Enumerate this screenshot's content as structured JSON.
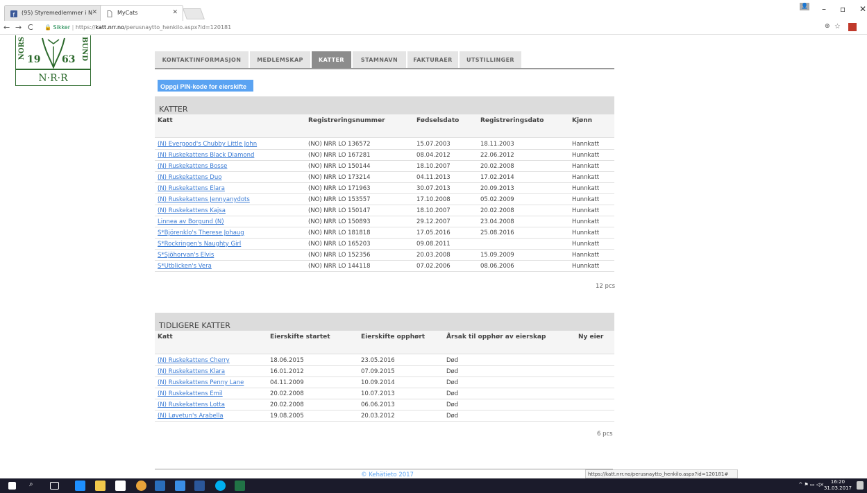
{
  "browser": {
    "tabs": [
      {
        "label": "(95) Styremedlemmer i N"
      },
      {
        "label": "MyCats"
      }
    ],
    "secure_label": "Sikker",
    "url_prefix": "https://",
    "url_host": "katt.nrr.no",
    "url_path": "/perusnaytto_henkilo.aspx?id=120181"
  },
  "logo": {
    "side_left": "NORS",
    "side_right": "BUND",
    "year_left": "19",
    "year_right": "63",
    "subtitle": "N·R·R"
  },
  "nav": {
    "tabs": [
      {
        "label": "KONTAKTINFORMASJON"
      },
      {
        "label": "MEDLEMSKAP"
      },
      {
        "label": "KATTER"
      },
      {
        "label": "STAMNAVN"
      },
      {
        "label": "FAKTURAER"
      },
      {
        "label": "UTSTILLINGER"
      }
    ]
  },
  "pin_button_label": "Oppgi PIN-kode for eierskifte",
  "katter": {
    "title": "KATTER",
    "headers": [
      "Katt",
      "Registreringsnummer",
      "Fødselsdato",
      "Registreringsdato",
      "Kjønn"
    ],
    "rows": [
      [
        "(N) Evergood's Chubby Little John",
        "(NO) NRR LO 136572",
        "15.07.2003",
        "18.11.2003",
        "Hannkatt"
      ],
      [
        "(N) Ruskekattens Black Diamond",
        "(NO) NRR LO 167281",
        "08.04.2012",
        "22.06.2012",
        "Hunnkatt"
      ],
      [
        "(N) Ruskekattens Bosse",
        "(NO) NRR LO 150144",
        "18.10.2007",
        "20.02.2008",
        "Hannkatt"
      ],
      [
        "(N) Ruskekattens Duo",
        "(NO) NRR LO 173214",
        "04.11.2013",
        "17.02.2014",
        "Hannkatt"
      ],
      [
        "(N) Ruskekattens Elara",
        "(NO) NRR LO 171963",
        "30.07.2013",
        "20.09.2013",
        "Hunnkatt"
      ],
      [
        "(N) Ruskekattens Jennyanydots",
        "(NO) NRR LO 153557",
        "17.10.2008",
        "05.02.2009",
        "Hunnkatt"
      ],
      [
        "(N) Ruskekattens Kajsa",
        "(NO) NRR LO 150147",
        "18.10.2007",
        "20.02.2008",
        "Hunnkatt"
      ],
      [
        "Linnea av Borgund (N)",
        "(NO) NRR LO 150893",
        "29.12.2007",
        "23.04.2008",
        "Hunnkatt"
      ],
      [
        "S*Björenklo's Therese Johaug",
        "(NO) NRR LO 181818",
        "17.05.2016",
        "25.08.2016",
        "Hunnkatt"
      ],
      [
        "S*Rockringen's Naughty Girl",
        "(NO) NRR LO 165203",
        "09.08.2011",
        "",
        "Hunnkatt"
      ],
      [
        "S*Sjöhorvan's Elvis",
        "(NO) NRR LO 152356",
        "20.03.2008",
        "15.09.2009",
        "Hannkatt"
      ],
      [
        "S*Utblicken's Vera",
        "(NO) NRR LO 144118",
        "07.02.2006",
        "08.06.2006",
        "Hunnkatt"
      ]
    ],
    "count": "12 pcs"
  },
  "tidligere": {
    "title": "TIDLIGERE KATTER",
    "headers": [
      "Katt",
      "Eierskifte startet",
      "Eierskifte opphørt",
      "Årsak til opphør av eierskap",
      "Ny eier"
    ],
    "rows": [
      [
        "(N) Ruskekattens Cherry",
        "18.06.2015",
        "23.05.2016",
        "Død",
        ""
      ],
      [
        "(N) Ruskekattens Klara",
        "16.01.2012",
        "07.09.2015",
        "Død",
        ""
      ],
      [
        "(N) Ruskekattens Penny Lane",
        "04.11.2009",
        "10.09.2014",
        "Død",
        ""
      ],
      [
        "(N) Ruskekattens Emil",
        "20.02.2008",
        "10.07.2013",
        "Død",
        ""
      ],
      [
        "(N) Ruskekattens Lotta",
        "20.02.2008",
        "06.06.2013",
        "Død",
        ""
      ],
      [
        "(N) Løvetun's Arabella",
        "19.08.2005",
        "20.03.2012",
        "Død",
        ""
      ]
    ],
    "count": "6 pcs"
  },
  "footer": "© Kehätieto 2017",
  "status_url": "https://katt.nrr.no/perusnaytto_henkilo.aspx?id=120181#",
  "clock": {
    "time": "16:20",
    "date": "31.03.2017"
  },
  "colors": {
    "accent": "#5aa3f2",
    "link": "#3a7bd5",
    "active_tab": "#8c8c8c",
    "logo_green": "#2d6a2d"
  }
}
